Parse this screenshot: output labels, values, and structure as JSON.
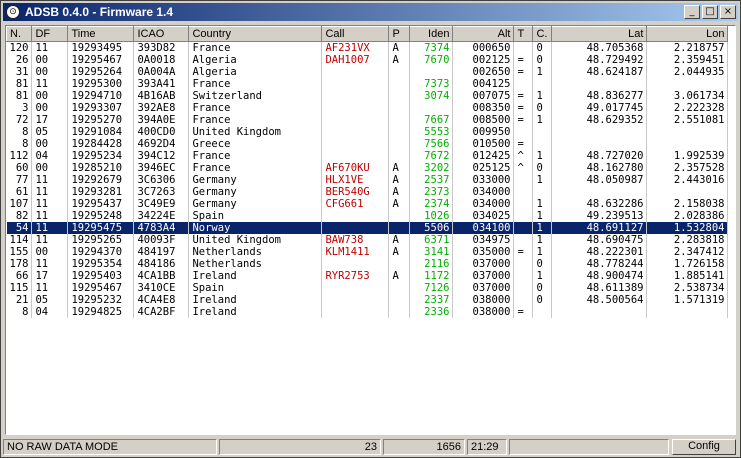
{
  "window": {
    "title": "ADSB 0.4.0 - Firmware 1.4"
  },
  "columns": [
    "N.",
    "DF",
    "Time",
    "ICAO",
    "Country",
    "Call",
    "P",
    "Iden",
    "Alt",
    "T",
    "C.",
    "Lat",
    "Lon"
  ],
  "rows": [
    [
      "120",
      "11",
      "19293495",
      "393D82",
      "France",
      "AF231VX",
      "A",
      "7374",
      "000650",
      "",
      "0",
      "48.705368",
      "2.218757"
    ],
    [
      "26",
      "00",
      "19295467",
      "0A0018",
      "Algeria",
      "DAH1007",
      "A",
      "7670",
      "002125",
      "=",
      "0",
      "48.729492",
      "2.359451"
    ],
    [
      "31",
      "00",
      "19295264",
      "0A004A",
      "Algeria",
      "",
      "",
      "",
      "002650",
      "=",
      "1",
      "48.624187",
      "2.044935"
    ],
    [
      "81",
      "11",
      "19295300",
      "393A41",
      "France",
      "",
      "",
      "7373",
      "004125",
      "",
      "",
      "",
      ""
    ],
    [
      "81",
      "00",
      "19294710",
      "4B16AB",
      "Switzerland",
      "",
      "",
      "3074",
      "007075",
      "=",
      "1",
      "48.836277",
      "3.061734"
    ],
    [
      "3",
      "00",
      "19293307",
      "392AE8",
      "France",
      "",
      "",
      "",
      "008350",
      "=",
      "0",
      "49.017745",
      "2.222328"
    ],
    [
      "72",
      "17",
      "19295270",
      "394A0E",
      "France",
      "",
      "",
      "7667",
      "008500",
      "=",
      "1",
      "48.629352",
      "2.551081"
    ],
    [
      "8",
      "05",
      "19291084",
      "400CD0",
      "United Kingdom",
      "",
      "",
      "5553",
      "009950",
      "",
      "",
      "",
      ""
    ],
    [
      "8",
      "00",
      "19284428",
      "4692D4",
      "Greece",
      "",
      "",
      "7566",
      "010500",
      "=",
      "",
      "",
      ""
    ],
    [
      "112",
      "04",
      "19295234",
      "394C12",
      "France",
      "",
      "",
      "7672",
      "012425",
      "^",
      "1",
      "48.727020",
      "1.992539"
    ],
    [
      "60",
      "00",
      "19285210",
      "3946EC",
      "France",
      "AF670KU",
      "A",
      "3202",
      "025125",
      "^",
      "0",
      "48.162780",
      "2.357528"
    ],
    [
      "77",
      "11",
      "19292679",
      "3C6306",
      "Germany",
      "HLX1VE",
      "A",
      "2537",
      "033000",
      "",
      "1",
      "48.050987",
      "2.443016"
    ],
    [
      "61",
      "11",
      "19293281",
      "3C7263",
      "Germany",
      "BER540G",
      "A",
      "2373",
      "034000",
      "",
      "",
      "",
      ""
    ],
    [
      "107",
      "11",
      "19295437",
      "3C49E9",
      "Germany",
      "CFG661",
      "A",
      "2374",
      "034000",
      "",
      "1",
      "48.632286",
      "2.158038"
    ],
    [
      "82",
      "11",
      "19295248",
      "34224E",
      "Spain",
      "",
      "",
      "1026",
      "034025",
      "",
      "1",
      "49.239513",
      "2.028386"
    ],
    [
      "54",
      "11",
      "19295475",
      "4783A4",
      "Norway",
      "",
      "",
      "5506",
      "034100",
      "",
      "1",
      "48.691127",
      "1.532804"
    ],
    [
      "114",
      "11",
      "19295265",
      "40093F",
      "United Kingdom",
      "BAW738",
      "A",
      "6371",
      "034975",
      "",
      "1",
      "48.690475",
      "2.283818"
    ],
    [
      "155",
      "00",
      "19294370",
      "484197",
      "Netherlands",
      "KLM1411",
      "A",
      "3141",
      "035000",
      "=",
      "1",
      "48.222301",
      "2.347412"
    ],
    [
      "178",
      "11",
      "19295354",
      "484186",
      "Netherlands",
      "",
      "",
      "2116",
      "037000",
      "",
      "0",
      "48.778244",
      "1.726158"
    ],
    [
      "66",
      "17",
      "19295403",
      "4CA1BB",
      "Ireland",
      "RYR2753",
      "A",
      "1172",
      "037000",
      "",
      "1",
      "48.900474",
      "1.885141"
    ],
    [
      "115",
      "11",
      "19295467",
      "3410CE",
      "Spain",
      "",
      "",
      "7126",
      "037000",
      "",
      "0",
      "48.611389",
      "2.538734"
    ],
    [
      "21",
      "05",
      "19295232",
      "4CA4E8",
      "Ireland",
      "",
      "",
      "2337",
      "038000",
      "",
      "0",
      "48.500564",
      "1.571319"
    ],
    [
      "8",
      "04",
      "19294825",
      "4CA2BF",
      "Ireland",
      "",
      "",
      "2336",
      "038000",
      "=",
      "",
      "",
      ""
    ]
  ],
  "selected_index": 15,
  "status": {
    "mode": "NO RAW DATA MODE",
    "count": "23",
    "messages": "1656",
    "clock": "21:29",
    "config_label": "Config"
  }
}
